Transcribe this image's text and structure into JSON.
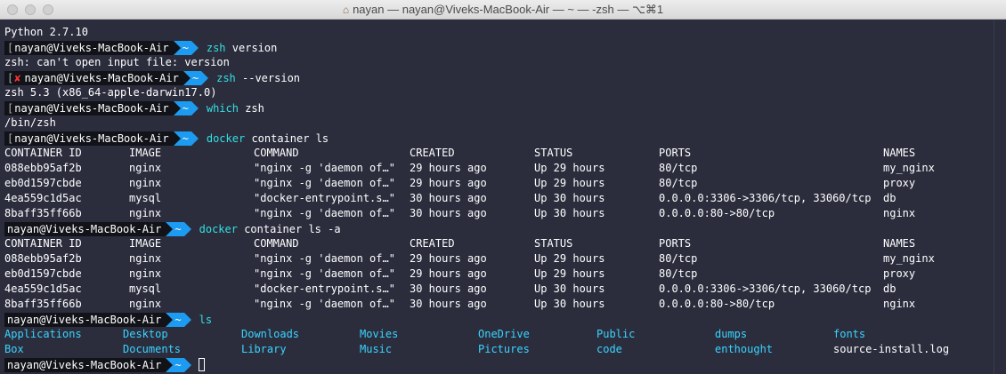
{
  "window": {
    "title": "nayan — nayan@Viveks-MacBook-Air — ~ — -zsh — ⌥⌘1"
  },
  "prompt": {
    "user": "nayan@Viveks-MacBook-Air",
    "dir": "~",
    "fail_mark": "✘"
  },
  "lines": {
    "python_version": "Python 2.7.10",
    "cmd1": {
      "command": "zsh",
      "args": " version"
    },
    "out1": "zsh: can't open input file: version",
    "cmd2": {
      "command": "zsh",
      "args": " --version"
    },
    "out2": "zsh 5.3 (x86_64-apple-darwin17.0)",
    "cmd3": {
      "command": "which",
      "args": " zsh"
    },
    "out3": "/bin/zsh",
    "cmd4": {
      "command": "docker",
      "args": " container ls"
    },
    "cmd5": {
      "command": "docker",
      "args": " container ls -a"
    },
    "cmd6": {
      "command": "ls",
      "args": ""
    }
  },
  "docker_table": {
    "headers": [
      "CONTAINER ID",
      "IMAGE",
      "COMMAND",
      "CREATED",
      "STATUS",
      "PORTS",
      "NAMES"
    ],
    "rows": [
      [
        "088ebb95af2b",
        "nginx",
        "\"nginx -g 'daemon of…\"",
        "29 hours ago",
        "Up 29 hours",
        "80/tcp",
        "my_nginx"
      ],
      [
        "eb0d1597cbde",
        "nginx",
        "\"nginx -g 'daemon of…\"",
        "29 hours ago",
        "Up 29 hours",
        "80/tcp",
        "proxy"
      ],
      [
        "4ea559c1d5ac",
        "mysql",
        "\"docker-entrypoint.s…\"",
        "30 hours ago",
        "Up 30 hours",
        "0.0.0.0:3306->3306/tcp, 33060/tcp",
        "db"
      ],
      [
        "8baff35ff66b",
        "nginx",
        "\"nginx -g 'daemon of…\"",
        "30 hours ago",
        "Up 30 hours",
        "0.0.0.0:80->80/tcp",
        "nginx"
      ]
    ]
  },
  "ls_output": {
    "row1": [
      "Applications",
      "Desktop",
      "Downloads",
      "Movies",
      "OneDrive",
      "Public",
      "dumps",
      "fonts"
    ],
    "row2": [
      "Box",
      "Documents",
      "Library",
      "Music",
      "Pictures",
      "code",
      "enthought",
      "source-install.log"
    ]
  },
  "colors": {
    "background": "#2b2d3d",
    "command": "#33e0e0",
    "directory": "#3ad4ff",
    "prompt_dir_bg": "#1d9bf0",
    "prompt_user_bg": "#111318",
    "error": "#ff3030"
  }
}
